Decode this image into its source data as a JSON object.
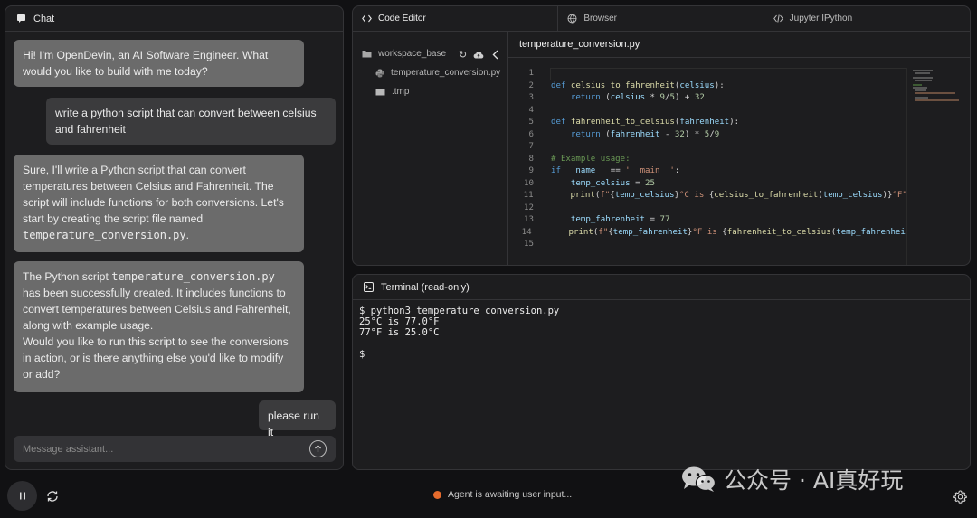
{
  "chat": {
    "title": "Chat",
    "messages": [
      {
        "role": "assistant",
        "text": "Hi! I'm OpenDevin, an AI Software Engineer. What would you like to build with me today?"
      },
      {
        "role": "user",
        "text": "write a python script that can convert between celsius and fahrenheit"
      },
      {
        "role": "assistant",
        "text_before": "Sure, I'll write a Python script that can convert temperatures between Celsius and Fahrenheit. The script will include functions for both conversions. Let's start by creating the script file named ",
        "code": "temperature_conversion.py",
        "text_after": "."
      },
      {
        "role": "assistant",
        "text_before": "The Python script ",
        "code": "temperature_conversion.py",
        "text_after": " has been successfully created. It includes functions to convert temperatures between Celsius and Fahrenheit, along with example usage.",
        "text_line2": "Would you like to run this script to see the conversions in action, or is there anything else you'd like to modify or add?"
      },
      {
        "role": "user",
        "text": "please run it"
      }
    ],
    "input_placeholder": "Message assistant..."
  },
  "tabs": [
    {
      "label": "Code Editor",
      "icon": "code-icon",
      "active": true
    },
    {
      "label": "Browser",
      "icon": "globe-icon",
      "active": false
    },
    {
      "label": "Jupyter IPython",
      "icon": "code-icon",
      "active": false
    }
  ],
  "filetree": {
    "root": "workspace_base",
    "items": [
      {
        "name": "temperature_conversion.py",
        "icon": "python-icon"
      },
      {
        "name": ".tmp",
        "icon": "folder-icon"
      }
    ]
  },
  "editor": {
    "file_name": "temperature_conversion.py",
    "line_numbers": [
      "1",
      "2",
      "3",
      "4",
      "5",
      "6",
      "7",
      "8",
      "9",
      "10",
      "11",
      "12",
      "13",
      "14",
      "15"
    ],
    "code_lines": [
      "",
      "def celsius_to_fahrenheit(celsius):",
      "    return (celsius * 9/5) + 32",
      "",
      "def fahrenheit_to_celsius(fahrenheit):",
      "    return (fahrenheit - 32) * 5/9",
      "",
      "# Example usage:",
      "if __name__ == '__main__':",
      "    temp_celsius = 25",
      "    print(f\"{temp_celsius}°C is {celsius_to_fahrenheit(temp_celsius)}°F\")",
      "",
      "    temp_fahrenheit = 77",
      "    print(f\"{temp_fahrenheit}°F is {fahrenheit_to_celsius(temp_fahrenheit)}°C\")",
      ""
    ]
  },
  "terminal": {
    "title": "Terminal (read-only)",
    "lines": [
      "$ python3 temperature_conversion.py",
      "25°C is 77.0°F",
      "77°F is 25.0°C",
      "",
      "$"
    ]
  },
  "status": {
    "text": "Agent is awaiting user input...",
    "color": "#e56b2d"
  },
  "watermark": {
    "text": "公众号 · AI真好玩"
  },
  "colors": {
    "background": "#111113",
    "panel": "#1d1d1f",
    "assistant_bubble": "#6b6b6b",
    "user_bubble": "#3b3b3d"
  }
}
